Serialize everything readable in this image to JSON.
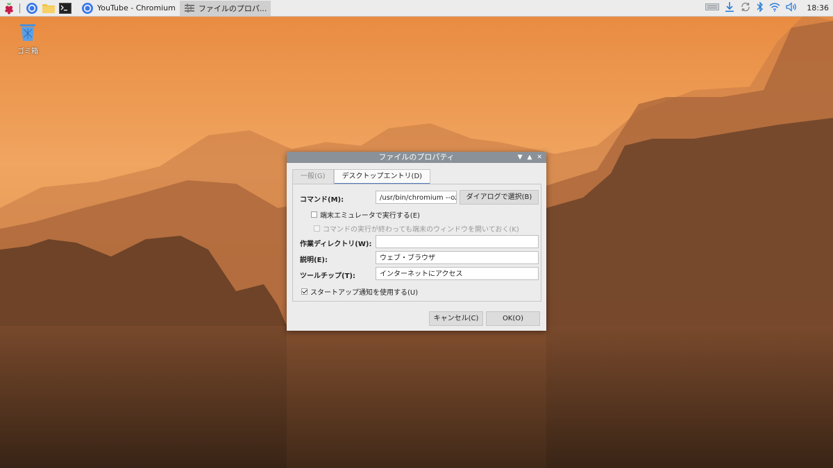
{
  "taskbar": {
    "buttons": [
      {
        "label": "YouTube - Chromium"
      },
      {
        "label": "ファイルのプロパ..."
      }
    ],
    "clock": "18:36"
  },
  "desktop": {
    "trash_label": "ゴミ箱"
  },
  "dialog": {
    "title": "ファイルのプロパティ",
    "tabs": [
      {
        "label": "一般(G)"
      },
      {
        "label": "デスクトップエントリ(D)"
      }
    ],
    "command": {
      "label": "コマンド(M):",
      "value": "/usr/bin/chromium --ozo",
      "browse_label": "ダイアログで選択(B)"
    },
    "terminal_checkbox": "端末エミュレータで実行する(E)",
    "keep_open_checkbox": "コマンドの実行が終わっても端末のウィンドウを開いておく(K)",
    "workdir": {
      "label": "作業ディレクトリ(W):",
      "value": ""
    },
    "description": {
      "label": "説明(E):",
      "value": "ウェブ・ブラウザ"
    },
    "tooltip": {
      "label": "ツールチップ(T):",
      "value": "インターネットにアクセス"
    },
    "startup_checkbox": "スタートアップ通知を使用する(U)",
    "cancel_label": "キャンセル(C)",
    "ok_label": "OK(O)"
  }
}
